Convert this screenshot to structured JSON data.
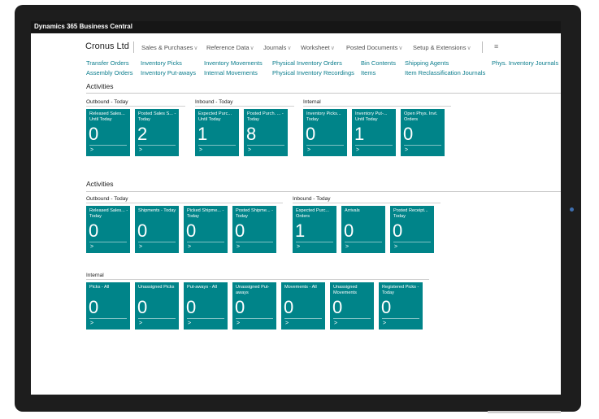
{
  "app": {
    "title": "Dynamics 365 Business Central"
  },
  "header": {
    "company": "Cronus Ltd",
    "menus": [
      {
        "label": "Sales & Purchases",
        "chevron": "∨"
      },
      {
        "label": "Reference Data",
        "chevron": "∨"
      },
      {
        "label": "Journals",
        "chevron": "∨"
      },
      {
        "label": "Worksheet",
        "chevron": "∨"
      },
      {
        "label": "Posted Documents",
        "chevron": "∨"
      },
      {
        "label": "Setup & Extensions",
        "chevron": "∨"
      }
    ],
    "more_icon": "≡"
  },
  "links": {
    "row1": [
      "Transfer Orders",
      "Inventory Picks",
      "Inventory Movements",
      "Physical Inventory Orders",
      "Bin Contents",
      "Shipping Agents",
      "Phys. Inventory Journals"
    ],
    "row2": [
      "Assembly Orders",
      "Inventory Put-aways",
      "Internal Movements",
      "Physical Inventory Recordings",
      "Items",
      "Item Reclassification Journals"
    ]
  },
  "activities1": {
    "title": "Activities",
    "groups": [
      {
        "title": "Outbound - Today",
        "tiles": [
          {
            "label": "Released Sales... Until Today",
            "value": "0",
            "chevron": ">"
          },
          {
            "label": "Posted Sales S... - Today",
            "value": "2",
            "chevron": ">"
          }
        ]
      },
      {
        "title": "Inbound - Today",
        "tiles": [
          {
            "label": "Expected Purc... Until Today",
            "value": "1",
            "chevron": ">"
          },
          {
            "label": "Posted Purch. ... - Today",
            "value": "8",
            "chevron": ">"
          }
        ]
      },
      {
        "title": "Internal",
        "tiles": [
          {
            "label": "Inventory Picks... Today",
            "value": "0",
            "chevron": ">"
          },
          {
            "label": "Inventory Put-... Until Today",
            "value": "1",
            "chevron": ">"
          },
          {
            "label": "Open Phys. Invt. Orders",
            "value": "0",
            "chevron": ">"
          }
        ]
      }
    ]
  },
  "activities2": {
    "title": "Activities",
    "groups": [
      {
        "title": "Outbound - Today",
        "tiles": [
          {
            "label": "Released Sales... - Today",
            "value": "0",
            "chevron": ">"
          },
          {
            "label": "Shipments - Today",
            "value": "0",
            "chevron": ">"
          },
          {
            "label": "Picked Shipme... - Today",
            "value": "0",
            "chevron": ">"
          },
          {
            "label": "Posted Shipme... - Today",
            "value": "0",
            "chevron": ">"
          }
        ]
      },
      {
        "title": "Inbound - Today",
        "tiles": [
          {
            "label": "Expected Purc... Orders",
            "value": "1",
            "chevron": ">"
          },
          {
            "label": "Arrivals",
            "value": "0",
            "chevron": ">"
          },
          {
            "label": "Posted Receipt... Today",
            "value": "0",
            "chevron": ">"
          }
        ]
      },
      {
        "title": "Internal",
        "tiles": [
          {
            "label": "Picks - All",
            "value": "0",
            "chevron": ">"
          },
          {
            "label": "Unassigned Picks",
            "value": "0",
            "chevron": ">"
          },
          {
            "label": "Put-aways - All",
            "value": "0",
            "chevron": ">"
          },
          {
            "label": "Unassigned Put-aways",
            "value": "0",
            "chevron": ">"
          },
          {
            "label": "Movements - All",
            "value": "0",
            "chevron": ">"
          },
          {
            "label": "Unassigned Movements",
            "value": "0",
            "chevron": ">"
          },
          {
            "label": "Registered Picks - Today",
            "value": "0",
            "chevron": ">"
          }
        ]
      }
    ]
  },
  "colors": {
    "tile": "#008489",
    "link": "#0a7c8c",
    "titlebar": "#161616"
  }
}
